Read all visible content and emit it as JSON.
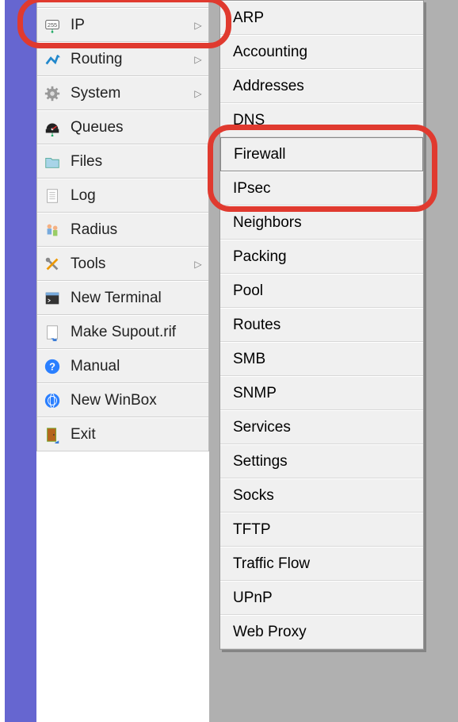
{
  "sidebar": {
    "items": [
      {
        "label": "",
        "icon": "blank"
      },
      {
        "label": "IP",
        "icon": "ip",
        "has_sub": true
      },
      {
        "label": "Routing",
        "icon": "routing",
        "has_sub": true
      },
      {
        "label": "System",
        "icon": "system",
        "has_sub": true
      },
      {
        "label": "Queues",
        "icon": "queues"
      },
      {
        "label": "Files",
        "icon": "files"
      },
      {
        "label": "Log",
        "icon": "log"
      },
      {
        "label": "Radius",
        "icon": "radius"
      },
      {
        "label": "Tools",
        "icon": "tools",
        "has_sub": true
      },
      {
        "label": "New Terminal",
        "icon": "terminal"
      },
      {
        "label": "Make Supout.rif",
        "icon": "supout"
      },
      {
        "label": "Manual",
        "icon": "manual"
      },
      {
        "label": "New WinBox",
        "icon": "winbox"
      },
      {
        "label": "Exit",
        "icon": "exit"
      }
    ]
  },
  "submenu": {
    "items": [
      "ARP",
      "Accounting",
      "Addresses",
      "DNS",
      "Firewall",
      "IPsec",
      "Neighbors",
      "Packing",
      "Pool",
      "Routes",
      "SMB",
      "SNMP",
      "Services",
      "Settings",
      "Socks",
      "TFTP",
      "Traffic Flow",
      "UPnP",
      "Web Proxy"
    ]
  },
  "highlights": {
    "sidebar_index": 1,
    "submenu_index": 4
  }
}
